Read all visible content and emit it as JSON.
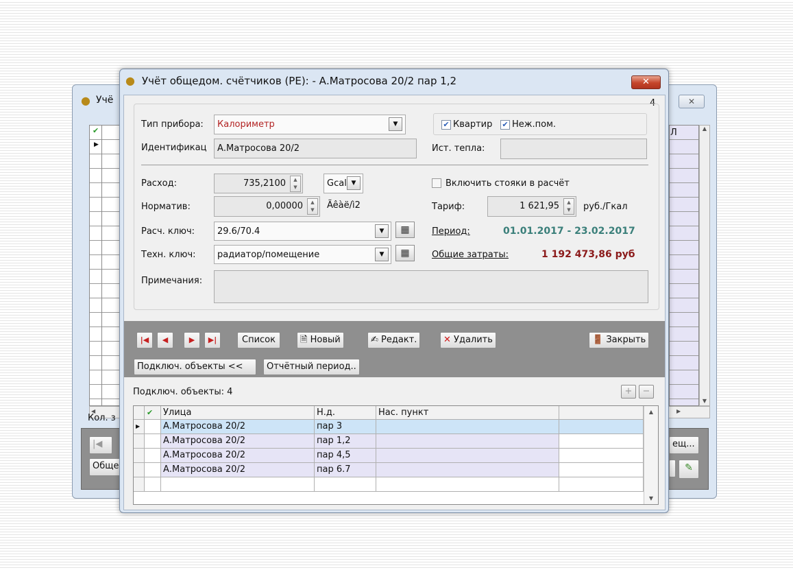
{
  "bg_window": {
    "title": "Учё",
    "close_glyph": "✕",
    "count_label": "Кол. з",
    "right_col_header": "Л",
    "btn_general": "Обще",
    "btn_rooms": "ещ...",
    "btn_first": "|◀"
  },
  "dialog": {
    "title": "Учёт общедом. счётчиков (PE): - А.Матросова 20/2 пар 1,2",
    "close_glyph": "✕",
    "record_number": "4"
  },
  "form": {
    "device_type_label": "Тип прибора:",
    "device_type_value": "Калориметр",
    "device_type_color": "#b22222",
    "identifier_label": "Идентификац",
    "identifier_value": "А.Матросова 20/2",
    "apartments_label": "Квартир",
    "apartments_checked": true,
    "nonres_label": "Неж.пом.",
    "nonres_checked": true,
    "heat_source_label": "Ист. тепла:",
    "heat_source_value": "",
    "consumption_label": "Расход:",
    "consumption_value": "735,2100",
    "unit_value": "Gcal",
    "norm_label": "Норматив:",
    "norm_value": "0,00000",
    "norm_unit": "Ãêàë/ì2",
    "include_risers_label": "Включить стояки в расчёт",
    "include_risers_checked": false,
    "tariff_label": "Тариф:",
    "tariff_value": "1 621,95",
    "tariff_unit": "руб./Гкал",
    "calc_key_label": "Расч. ключ:",
    "calc_key_value": "29.6/70.4",
    "tech_key_label": "Техн. ключ:",
    "tech_key_value": "радиатор/помещение",
    "period_label": "Период:",
    "period_value": "01.01.2017 - 23.02.2017",
    "period_color": "#3a7f7a",
    "total_label": "Общие затраты:",
    "total_value": "1 192 473,86 руб",
    "total_color": "#8b1a1a",
    "notes_label": "Примечания:",
    "notes_value": ""
  },
  "toolbar": {
    "list_label": "Список",
    "new_label": "Новый",
    "edit_label": "Редакт.",
    "delete_label": "Удалить",
    "close_label": "Закрыть",
    "connected_objects_label": "Подключ. объекты <<",
    "report_period_label": "Отчётный период.."
  },
  "connected": {
    "caption": "Подключ. объекты:",
    "count": "4",
    "columns": [
      "Улица",
      "Н.д.",
      "Нас. пункт"
    ],
    "rows": [
      {
        "street": "А.Матросова 20/2",
        "house": "пар 3",
        "settlement": ""
      },
      {
        "street": "А.Матросова 20/2",
        "house": "пар 1,2",
        "settlement": ""
      },
      {
        "street": "А.Матросова 20/2",
        "house": "пар 4,5",
        "settlement": ""
      },
      {
        "street": "А.Матросова 20/2",
        "house": "пар 6.7",
        "settlement": ""
      }
    ]
  },
  "colors": {
    "selected_row": "#cde4f7",
    "row_alt": "#e6e4f6",
    "panel_gray": "#8f8f8f"
  }
}
